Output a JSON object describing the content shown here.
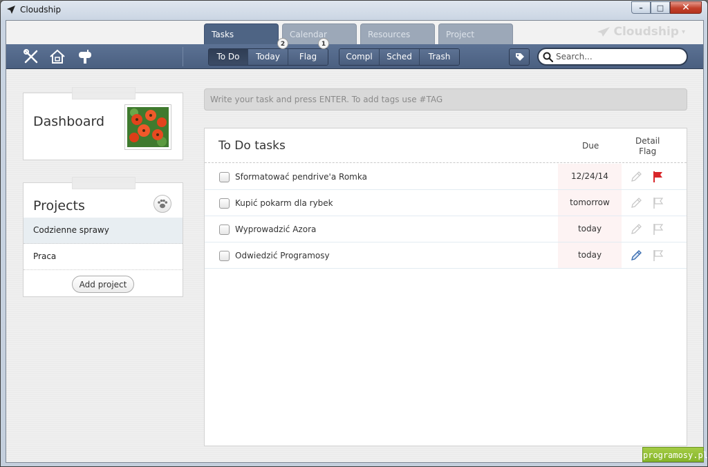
{
  "window": {
    "title": "Cloudship",
    "min_icon": "minimize-icon",
    "max_icon": "maximize-icon",
    "close_icon": "close-icon"
  },
  "tabs": [
    {
      "label": "Tasks",
      "active": true
    },
    {
      "label": "Calendar",
      "active": false
    },
    {
      "label": "Resources",
      "active": false
    },
    {
      "label": "Project",
      "active": false
    }
  ],
  "brand": {
    "label": "Cloudship",
    "icon": "paper-plane-icon"
  },
  "toolbar": {
    "icons": [
      "tools-icon",
      "home-icon",
      "mailbox-icon"
    ],
    "filters": [
      {
        "label": "To Do",
        "pressed": true
      },
      {
        "label": "Today",
        "badge": "2"
      },
      {
        "label": "Flag",
        "badge": "1"
      }
    ],
    "views": [
      {
        "label": "Compl"
      },
      {
        "label": "Sched"
      },
      {
        "label": "Trash"
      }
    ],
    "tag_icon": "tag-icon",
    "search_placeholder": "Search..."
  },
  "sidebar": {
    "dashboard": {
      "title": "Dashboard",
      "image": "red-flowers-photo"
    },
    "projects": {
      "title": "Projects",
      "icon": "paw-icon",
      "items": [
        {
          "label": "Codzienne sprawy",
          "selected": true
        },
        {
          "label": "Praca",
          "selected": false
        }
      ],
      "add_label": "Add project"
    }
  },
  "task_input": {
    "placeholder": "Write your task and press ENTER. To add tags use #TAG"
  },
  "tasks": {
    "title": "To Do tasks",
    "col_due": "Due",
    "col_detail": "Detail",
    "col_flag": "Flag",
    "rows": [
      {
        "text": "Sformatować pendrive'a Romka",
        "due": "12/24/14",
        "detail_active": false,
        "flagged": true
      },
      {
        "text": "Kupić pokarm dla rybek",
        "due": "tomorrow",
        "detail_active": false,
        "flagged": false
      },
      {
        "text": "Wyprowadzić Azora",
        "due": "today",
        "detail_active": false,
        "flagged": false
      },
      {
        "text": "Odwiedzić Programosy",
        "due": "today",
        "detail_active": true,
        "flagged": false
      }
    ],
    "colors": {
      "flag_active": "#d8262a",
      "pencil_active": "#3a6db0",
      "inactive": "#c8c8c8"
    }
  },
  "watermark": "programosy.pl"
}
